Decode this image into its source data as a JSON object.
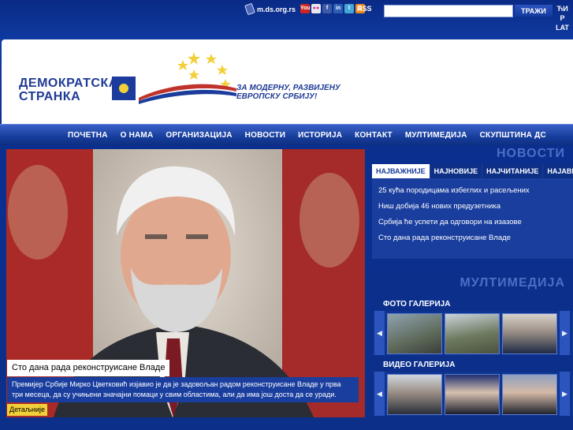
{
  "topbar": {
    "mobile_label": "m.ds.org.rs",
    "social_icons": [
      {
        "name": "youtube-icon",
        "glyph": "You",
        "color": "#d0261f"
      },
      {
        "name": "flickr-icon",
        "glyph": "●●",
        "color": "#e8e8ee"
      },
      {
        "name": "facebook-icon",
        "glyph": "f",
        "color": "#3b5ba8"
      },
      {
        "name": "myspace-icon",
        "glyph": "in",
        "color": "#2a60b8"
      },
      {
        "name": "twitter-icon",
        "glyph": "t",
        "color": "#45a6d8"
      },
      {
        "name": "rss-icon",
        "glyph": "))",
        "color": "#ee8a1c"
      }
    ],
    "rss_label": "RSS",
    "search_placeholder": "",
    "search_button": "ТРАЖИ",
    "lang_1": "ЋИ",
    "lang_2": "Р",
    "lang_3": "LAT"
  },
  "header": {
    "logo_line1": "ДЕМОКРАТСКА",
    "logo_line2": "СТРАНКА",
    "slogan_line1": "ЗА МОДЕРНУ, РАЗВИЈЕНУ",
    "slogan_line2": "ЕВРОПСКУ СРБИЈУ!"
  },
  "nav": {
    "items": [
      "ПОЧЕТНА",
      "О НАМА",
      "ОРГАНИЗАЦИЈА",
      "НОВОСТИ",
      "ИСТОРИЈА",
      "КОНТАКТ",
      "МУЛТИМЕДИЈА",
      "СКУПШТИНА ДС"
    ]
  },
  "feature": {
    "title": "Сто дана рада реконструисане Владе",
    "summary": "Премијер Србије Мирко Цветковић изјавио је да је задовољан радом реконструисане Владе у прва три месеца, да су учињени значајни помаци у свим областима, али да има још доста да се уради.",
    "more_label": "Детаљније"
  },
  "news": {
    "section_title": "НОВОСТИ",
    "tabs": [
      "НАЈВАЖНИЈЕ",
      "НАЈНОВИЈЕ",
      "НАЈЧИТАНИЈЕ",
      "НАЈАВЕ"
    ],
    "items": [
      "25 кућа породицама избеглих и расељених",
      "Ниш добија 46 нових предузетника",
      "Србија ће успети да одговори на изазове",
      "Сто дана рада реконструисане Владе"
    ]
  },
  "multimedia": {
    "section_title": "МУЛТИМЕДИЈА",
    "photo_label": "ФОТО ГАЛЕРИЈА",
    "video_label": "ВИДЕО ГАЛЕРИЈА",
    "prev_label": "◀",
    "next_label": "▶"
  },
  "colors": {
    "brand_blue": "#1a3e9e",
    "accent_yellow": "#f2d03a",
    "flag_red": "#c0332c"
  }
}
